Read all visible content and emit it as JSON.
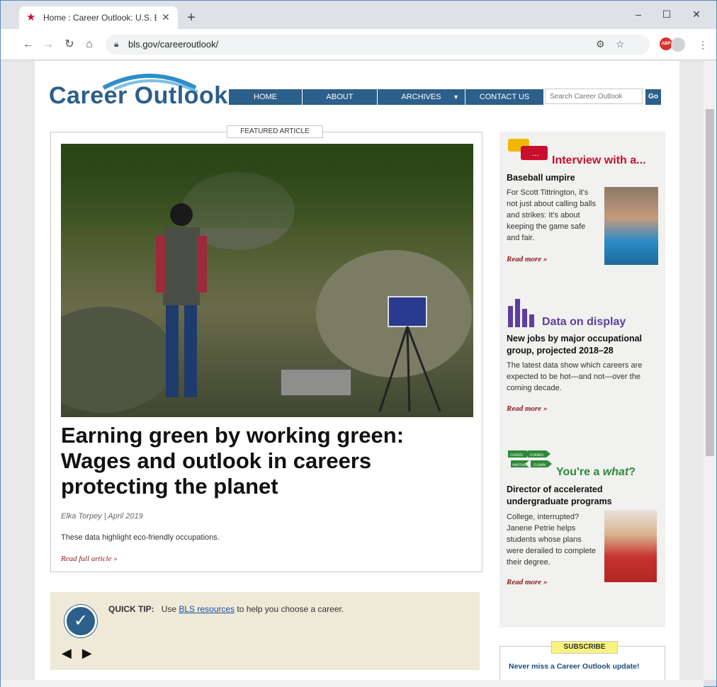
{
  "browser": {
    "tab_title": "Home : Career Outlook: U.S. Bure",
    "tab_close": "✕",
    "new_tab": "+",
    "url": "bls.gov/careeroutlook/",
    "window_controls": [
      "–",
      "☐",
      "✕"
    ],
    "extension_label": "ABP"
  },
  "header": {
    "logo_text": "Career Outlook",
    "nav": [
      "HOME",
      "ABOUT",
      "ARCHIVES",
      "CONTACT US"
    ],
    "search_placeholder": "Search Career Outlook",
    "go_label": "Go"
  },
  "featured": {
    "label": "FEATURED ARTICLE",
    "title": "Earning green by working green: Wages and outlook in careers protecting the planet",
    "byline": "Elka Torpey | April 2019",
    "summary": "These data highlight eco-friendly occupations.",
    "read_more": "Read full article »"
  },
  "quick_tip": {
    "label": "QUICK TIP:",
    "text_before": "Use",
    "link": "BLS resources",
    "text_after": "to help you choose a career.",
    "prev": "◀",
    "next": "▶"
  },
  "sidebar": {
    "interview": {
      "heading": "Interview with a...",
      "subtitle": "Baseball umpire",
      "text": "For Scott Tittrington, it's not just about calling balls and strikes: It's about keeping the game safe and fair.",
      "read_more": "Read more »"
    },
    "data_display": {
      "heading": "Data on display",
      "subtitle": "New jobs by major occupational group, projected 2018–28",
      "text": "The latest data show which careers are expected to be hot—and not—over the coming decade.",
      "read_more": "Read more »"
    },
    "youre_a_what": {
      "heading_prefix": "You're a",
      "heading_em": "what",
      "heading_suffix": "?",
      "subtitle": "Director of accelerated undergraduate programs",
      "text": "College, interrupted? Janene Petrie helps students whose plans were derailed to complete their degree.",
      "read_more": "Read more »",
      "sign_words": [
        "CAREER",
        "CORNER",
        "ANOTHER",
        "CLOWN"
      ]
    }
  },
  "subscribe": {
    "label": "SUBSCRIBE",
    "text": "Never miss a Career Outlook update!"
  },
  "colors": {
    "brand_blue": "#2c5f8a",
    "interview_red": "#c8102e",
    "data_purple": "#5c3f9e",
    "what_green": "#2d8a3a",
    "read_more_red": "#8b1a1a",
    "tip_bg": "#efe9d7"
  }
}
